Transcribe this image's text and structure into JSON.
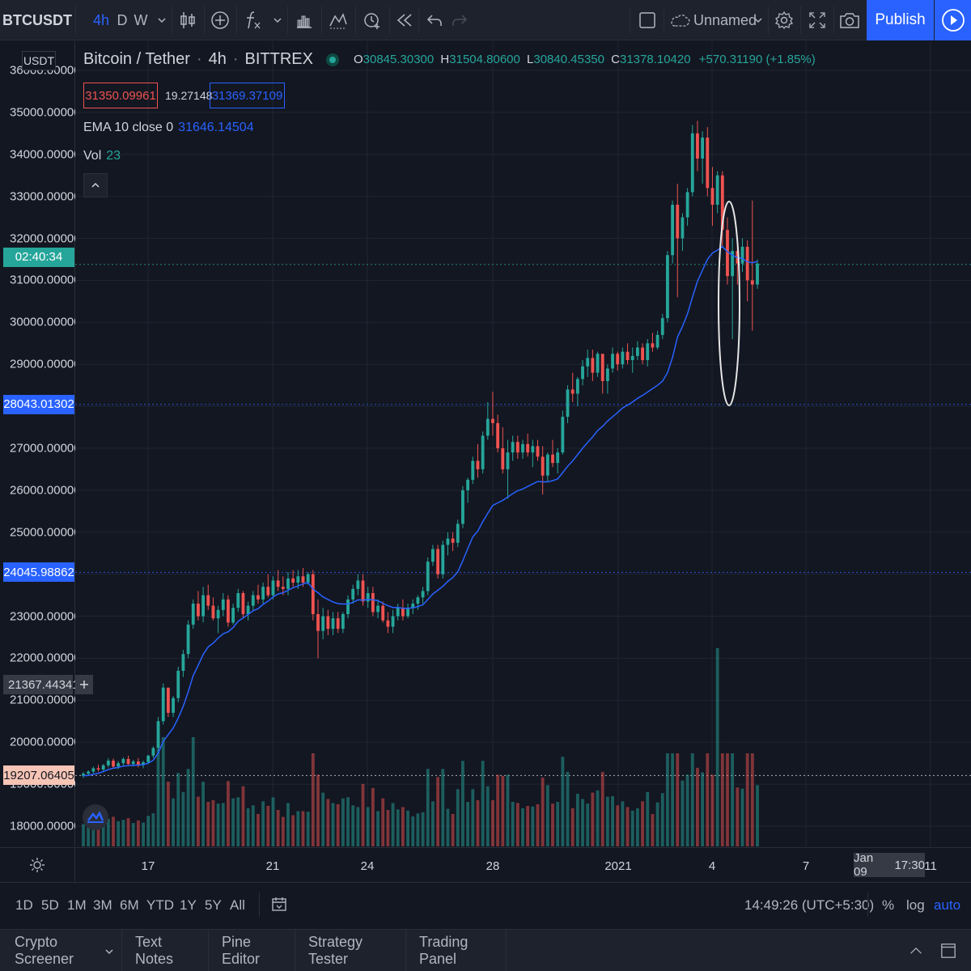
{
  "toolbar": {
    "symbol": "BTCUSDT",
    "timeframes": [
      "4h",
      "D",
      "W"
    ],
    "active_timeframe": "4h",
    "layout_name": "Unnamed",
    "publish_label": "Publish"
  },
  "legend": {
    "pair": "Bitcoin / Tether",
    "interval": "4h",
    "exchange": "BITTREX",
    "open_label": "O",
    "open": "30845.30300",
    "high_label": "H",
    "high": "31504.80600",
    "low_label": "L",
    "low": "30840.45350",
    "close_label": "C",
    "close": "31378.10420",
    "change": "+570.31190 (+1.85%)",
    "bid": "31350.09961",
    "spread": "19.27148",
    "ask": "31369.37109"
  },
  "indicators": {
    "ema_label": "EMA 10 close 0",
    "ema_value": "31646.14504",
    "vol_label": "Vol",
    "vol_value": "23"
  },
  "price_axis": {
    "currency": "USDT",
    "labels": [
      "36000.00000",
      "35000.00000",
      "34000.00000",
      "33000.00000",
      "32000.00000",
      "31000.00000",
      "30000.00000",
      "29000.00000",
      "27000.00000",
      "26000.00000",
      "25000.00000",
      "23000.00000",
      "22000.00000",
      "21000.00000",
      "20000.00000",
      "19000.00000",
      "18000.00000"
    ],
    "label_values": [
      36000,
      35000,
      34000,
      33000,
      32000,
      31000,
      30000,
      29000,
      27000,
      26000,
      25000,
      23000,
      22000,
      21000,
      20000,
      19000,
      18000
    ],
    "countdown": "02:40:34",
    "line_28043": "28043.01302",
    "line_24045": "24045.98862",
    "crosshair": "21367.44341",
    "line_19207": "19207.06405",
    "countdown_color": "#26a69a",
    "blue_tag_color": "#2962ff",
    "crosshair_tag_color": "#363a45",
    "orange_tag_color": "#f7c5b5"
  },
  "time_axis": {
    "labels": [
      "17",
      "21",
      "24",
      "28",
      "2021",
      "4",
      "7",
      "11"
    ],
    "cursor_date": "Jan 09",
    "cursor_time": "17:30"
  },
  "range_bar": {
    "ranges": [
      "1D",
      "5D",
      "1M",
      "3M",
      "6M",
      "YTD",
      "1Y",
      "5Y",
      "All"
    ],
    "clock": "14:49:26 (UTC+5:30)",
    "percent": "%",
    "log": "log",
    "auto": "auto"
  },
  "panels": [
    "Crypto Screener",
    "Text Notes",
    "Pine Editor",
    "Strategy Tester",
    "Trading Panel"
  ],
  "chart_data": {
    "type": "candlestick",
    "y_range": [
      17500,
      36500
    ],
    "up_color": "#26a69a",
    "down_color": "#ef5350",
    "ema_color": "#2962ff",
    "candles": [
      [
        19200,
        19290,
        19150,
        19250
      ],
      [
        19250,
        19330,
        19200,
        19300
      ],
      [
        19300,
        19420,
        19260,
        19380
      ],
      [
        19380,
        19460,
        19300,
        19350
      ],
      [
        19350,
        19480,
        19280,
        19450
      ],
      [
        19450,
        19620,
        19400,
        19560
      ],
      [
        19560,
        19610,
        19380,
        19420
      ],
      [
        19420,
        19550,
        19360,
        19500
      ],
      [
        19500,
        19640,
        19440,
        19600
      ],
      [
        19600,
        19680,
        19460,
        19480
      ],
      [
        19480,
        19580,
        19420,
        19540
      ],
      [
        19540,
        19620,
        19400,
        19460
      ],
      [
        19460,
        19560,
        19380,
        19520
      ],
      [
        19520,
        19700,
        19480,
        19680
      ],
      [
        19680,
        19900,
        19620,
        19860
      ],
      [
        19860,
        20600,
        19800,
        20500
      ],
      [
        20500,
        21400,
        20420,
        21300
      ],
      [
        21300,
        21200,
        20600,
        20700
      ],
      [
        20700,
        21100,
        20600,
        21050
      ],
      [
        21050,
        21800,
        20950,
        21700
      ],
      [
        21700,
        22200,
        21550,
        22100
      ],
      [
        22100,
        22900,
        22000,
        22800
      ],
      [
        22800,
        23400,
        22700,
        23300
      ],
      [
        23300,
        23600,
        22900,
        23000
      ],
      [
        23000,
        23700,
        22850,
        23500
      ],
      [
        23500,
        23750,
        23150,
        23250
      ],
      [
        23250,
        23450,
        22900,
        22950
      ],
      [
        22950,
        23250,
        22600,
        23150
      ],
      [
        23150,
        23550,
        23000,
        23400
      ],
      [
        23400,
        23500,
        22750,
        22850
      ],
      [
        22850,
        23300,
        22800,
        23200
      ],
      [
        23200,
        23650,
        23100,
        23550
      ],
      [
        23550,
        23600,
        22950,
        23050
      ],
      [
        23050,
        23350,
        22900,
        23250
      ],
      [
        23250,
        23600,
        23150,
        23500
      ],
      [
        23500,
        23750,
        23300,
        23400
      ],
      [
        23400,
        23800,
        23300,
        23700
      ],
      [
        23700,
        24000,
        23450,
        23500
      ],
      [
        23500,
        23950,
        23400,
        23850
      ],
      [
        23850,
        24100,
        23600,
        23700
      ],
      [
        23700,
        23950,
        23500,
        23650
      ],
      [
        23650,
        24050,
        23500,
        23900
      ],
      [
        23900,
        24100,
        23700,
        23800
      ],
      [
        23800,
        24100,
        23650,
        23950
      ],
      [
        23950,
        24150,
        23700,
        23800
      ],
      [
        23800,
        24050,
        23750,
        24000
      ],
      [
        24000,
        24100,
        22900,
        23050
      ],
      [
        23050,
        23400,
        22000,
        22650
      ],
      [
        22650,
        23200,
        22450,
        23000
      ],
      [
        23000,
        23150,
        22550,
        22700
      ],
      [
        22700,
        23100,
        22550,
        22950
      ],
      [
        22950,
        23100,
        22600,
        22700
      ],
      [
        22700,
        23100,
        22600,
        23050
      ],
      [
        23050,
        23500,
        22950,
        23400
      ],
      [
        23400,
        23750,
        23300,
        23650
      ],
      [
        23650,
        24000,
        23500,
        23850
      ],
      [
        23850,
        24000,
        23250,
        23350
      ],
      [
        23350,
        23700,
        23200,
        23550
      ],
      [
        23550,
        23700,
        23000,
        23100
      ],
      [
        23100,
        23400,
        22950,
        23250
      ],
      [
        23250,
        23350,
        22850,
        22900
      ],
      [
        22900,
        23100,
        22600,
        22750
      ],
      [
        22750,
        23150,
        22600,
        23000
      ],
      [
        23000,
        23300,
        22900,
        23200
      ],
      [
        23200,
        23400,
        22900,
        23000
      ],
      [
        23000,
        23300,
        22950,
        23200
      ],
      [
        23200,
        23400,
        23050,
        23300
      ],
      [
        23300,
        23500,
        23150,
        23450
      ],
      [
        23450,
        23700,
        23300,
        23600
      ],
      [
        23600,
        24400,
        23500,
        24300
      ],
      [
        24300,
        24700,
        24200,
        24600
      ],
      [
        24600,
        24700,
        23900,
        24000
      ],
      [
        24000,
        24800,
        23900,
        24700
      ],
      [
        24700,
        25000,
        24450,
        24850
      ],
      [
        24850,
        25000,
        24550,
        24750
      ],
      [
        24750,
        25300,
        24650,
        25200
      ],
      [
        25200,
        26100,
        25100,
        26000
      ],
      [
        26000,
        26300,
        25700,
        26250
      ],
      [
        26250,
        26800,
        26150,
        26700
      ],
      [
        26700,
        27100,
        26300,
        26500
      ],
      [
        26500,
        27400,
        26400,
        27300
      ],
      [
        27300,
        28100,
        27200,
        27700
      ],
      [
        27700,
        28350,
        27300,
        27600
      ],
      [
        27600,
        27800,
        26900,
        27000
      ],
      [
        27000,
        27500,
        26400,
        26500
      ],
      [
        26500,
        27200,
        25800,
        26900
      ],
      [
        26900,
        27300,
        26700,
        27150
      ],
      [
        27150,
        27300,
        26750,
        26900
      ],
      [
        26900,
        27200,
        26750,
        27100
      ],
      [
        27100,
        27350,
        26800,
        26900
      ],
      [
        26900,
        27200,
        26550,
        27050
      ],
      [
        27050,
        27200,
        26700,
        26800
      ],
      [
        26800,
        27050,
        25900,
        26350
      ],
      [
        26350,
        26900,
        26200,
        26850
      ],
      [
        26850,
        27200,
        26550,
        26650
      ],
      [
        26650,
        27000,
        26400,
        26900
      ],
      [
        26900,
        27900,
        26850,
        27750
      ],
      [
        27750,
        28500,
        27600,
        28400
      ],
      [
        28400,
        28800,
        28100,
        28300
      ],
      [
        28300,
        28700,
        28000,
        28650
      ],
      [
        28650,
        29100,
        28500,
        28950
      ],
      [
        28950,
        29350,
        28700,
        29150
      ],
      [
        29150,
        29350,
        28600,
        28800
      ],
      [
        28800,
        29300,
        28700,
        29250
      ],
      [
        29250,
        29200,
        28300,
        28600
      ],
      [
        28600,
        29000,
        28300,
        28900
      ],
      [
        28900,
        29400,
        28800,
        29250
      ],
      [
        29250,
        29300,
        28850,
        29000
      ],
      [
        29000,
        29400,
        28900,
        29300
      ],
      [
        29300,
        29500,
        29000,
        29100
      ],
      [
        29100,
        29400,
        28800,
        29200
      ],
      [
        29200,
        29550,
        29100,
        29400
      ],
      [
        29400,
        29500,
        29000,
        29100
      ],
      [
        29100,
        29600,
        28950,
        29500
      ],
      [
        29500,
        29750,
        29300,
        29400
      ],
      [
        29400,
        29800,
        29350,
        29700
      ],
      [
        29700,
        30200,
        29600,
        30100
      ],
      [
        30100,
        31700,
        30000,
        31600
      ],
      [
        31600,
        32900,
        31400,
        32800
      ],
      [
        32800,
        33300,
        30600,
        32000
      ],
      [
        32000,
        32600,
        31700,
        32500
      ],
      [
        32500,
        33200,
        32300,
        33100
      ],
      [
        33100,
        34700,
        33000,
        34500
      ],
      [
        34500,
        34800,
        33600,
        33900
      ],
      [
        33900,
        34550,
        33300,
        34400
      ],
      [
        34400,
        34650,
        33000,
        33200
      ],
      [
        33200,
        33700,
        32300,
        32800
      ],
      [
        32800,
        33600,
        32600,
        33500
      ],
      [
        33500,
        33600,
        31800,
        32200
      ],
      [
        32200,
        32500,
        30900,
        31100
      ],
      [
        31100,
        32000,
        29600,
        31700
      ],
      [
        31700,
        32000,
        30900,
        31400
      ],
      [
        31400,
        32000,
        31200,
        31800
      ],
      [
        31800,
        31950,
        30500,
        31000
      ],
      [
        31000,
        32900,
        29800,
        30900
      ],
      [
        30900,
        31500,
        30800,
        31400
      ]
    ],
    "ema": [
      19200,
      19210,
      19235,
      19260,
      19300,
      19350,
      19380,
      19400,
      19430,
      19440,
      19450,
      19455,
      19465,
      19500,
      19570,
      19740,
      20020,
      20180,
      20340,
      20570,
      20850,
      21200,
      21580,
      21830,
      22090,
      22270,
      22360,
      22480,
      22580,
      22630,
      22730,
      22880,
      22960,
      23040,
      23130,
      23180,
      23280,
      23360,
      23460,
      23530,
      23560,
      23620,
      23680,
      23720,
      23770,
      23800,
      23650,
      23560,
      23460,
      23400,
      23340,
      23300,
      23290,
      23290,
      23330,
      23390,
      23380,
      23400,
      23390,
      23370,
      23310,
      23250,
      23210,
      23210,
      23190,
      23190,
      23200,
      23230,
      23270,
      23400,
      23530,
      23620,
      23710,
      23830,
      23920,
      24060,
      24320,
      24610,
      24890,
      25030,
      25250,
      25450,
      25640,
      25700,
      25760,
      25840,
      25920,
      25990,
      26030,
      26090,
      26150,
      26210,
      26200,
      26200,
      26230,
      26270,
      26420,
      26570,
      26700,
      26850,
      27000,
      27140,
      27270,
      27420,
      27520,
      27650,
      27750,
      27850,
      27960,
      28030,
      28100,
      28190,
      28260,
      28340,
      28420,
      28500,
      28600,
      28800,
      29160,
      29650,
      29900,
      30200,
      30600,
      30980,
      31240,
      31500,
      31650,
      31720,
      31800,
      31680,
      31600,
      31540,
      31520,
      31440,
      31420,
      31450
    ]
  }
}
